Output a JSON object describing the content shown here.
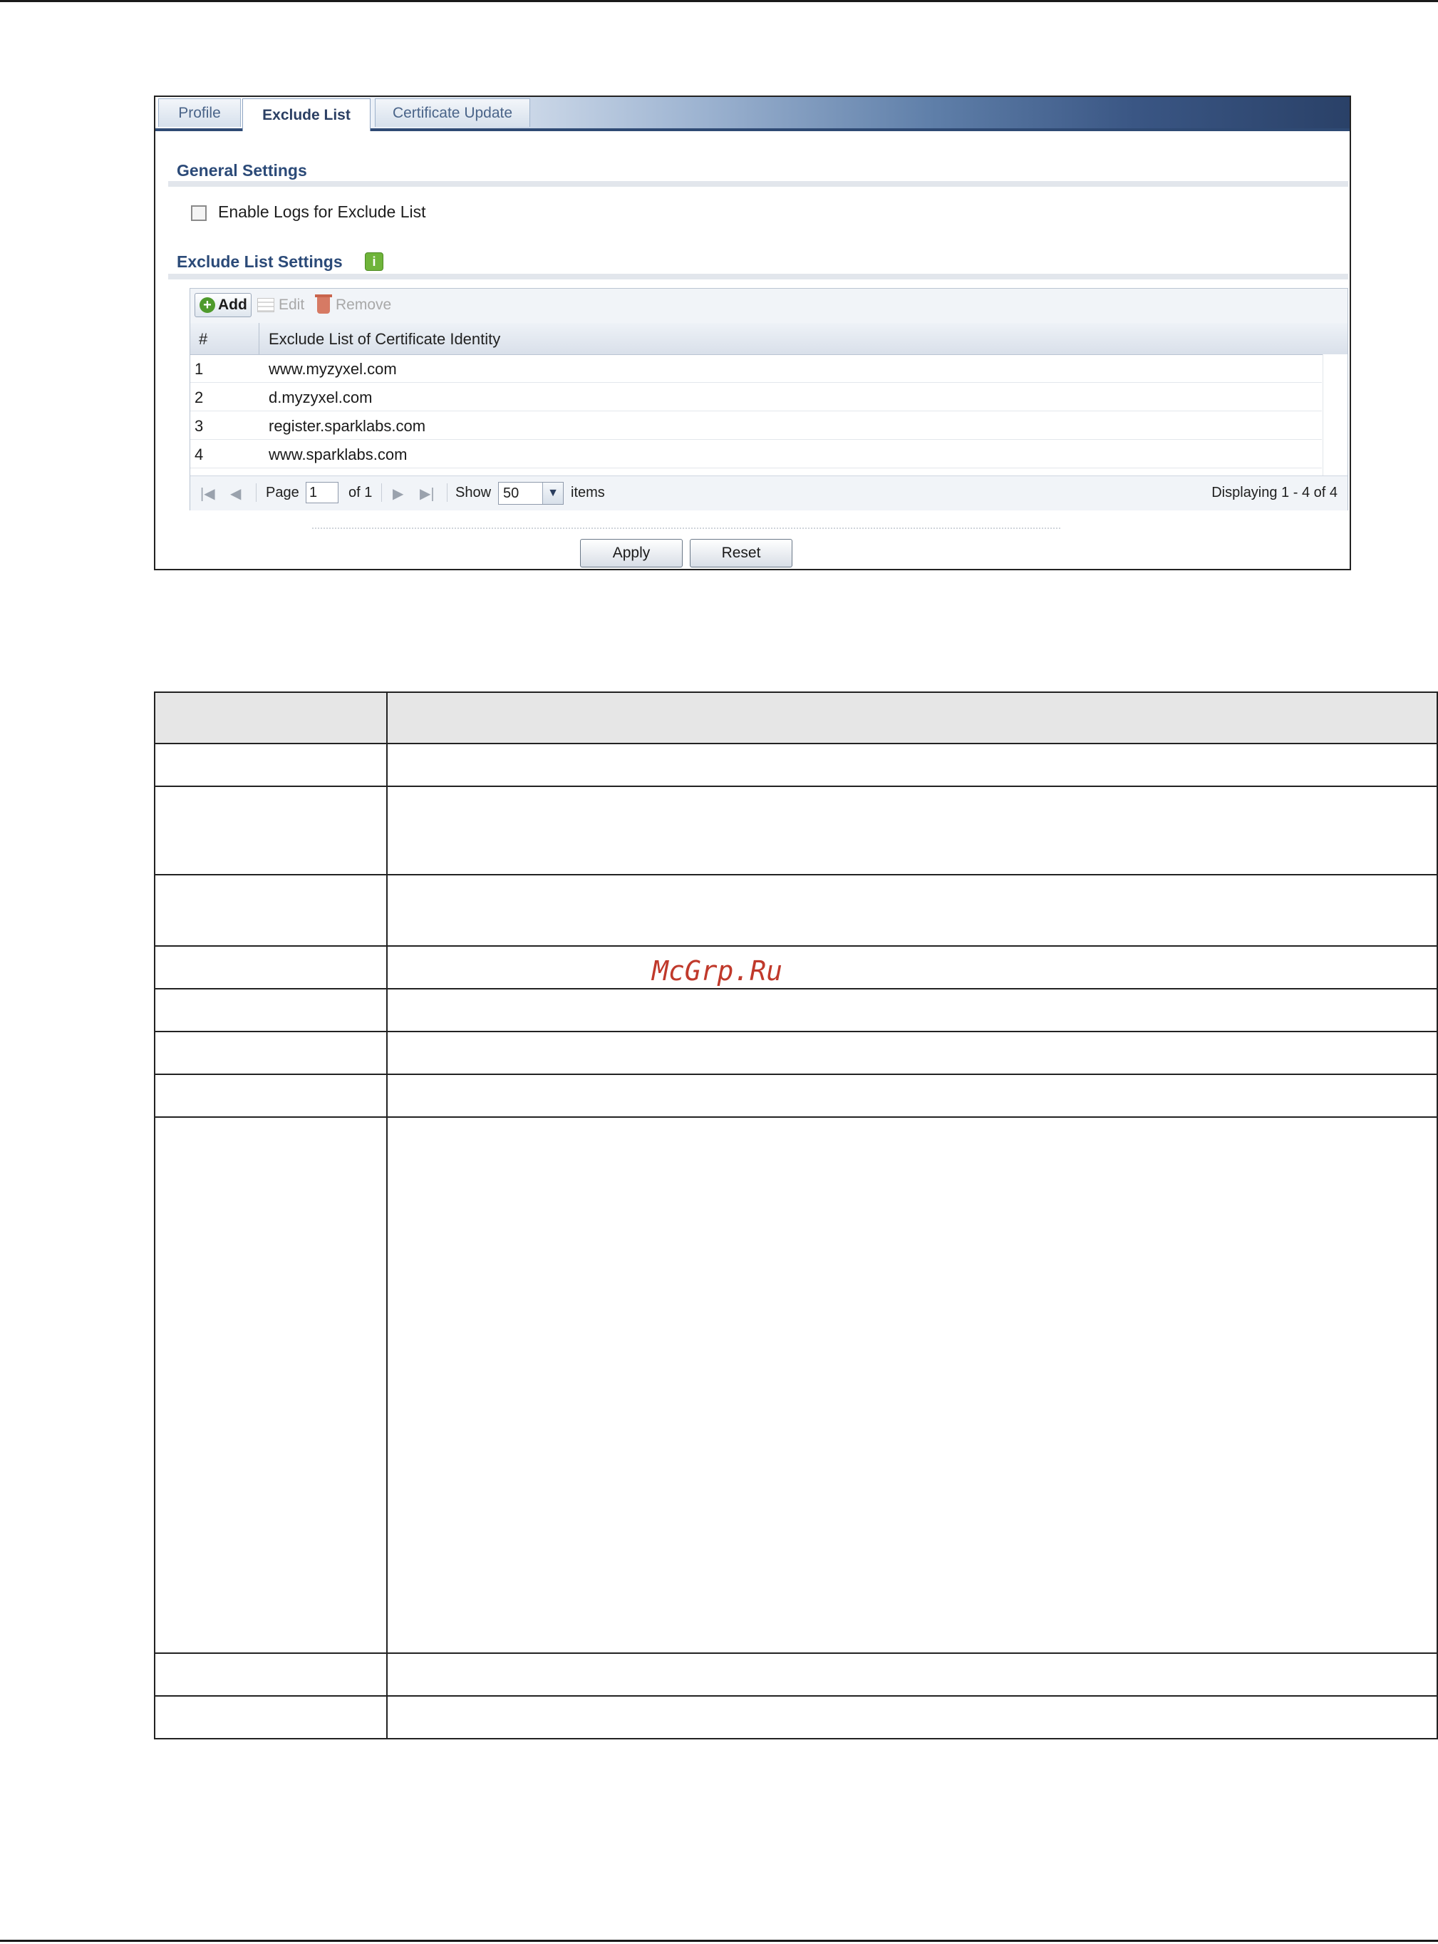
{
  "tabs": [
    {
      "label": "Profile",
      "active": false
    },
    {
      "label": "Exclude List",
      "active": true
    },
    {
      "label": "Certificate Update",
      "active": false
    }
  ],
  "general_settings": {
    "title": "General Settings",
    "enable_logs_label": "Enable Logs for Exclude List",
    "enable_logs_checked": false
  },
  "exclude_list_settings": {
    "title": "Exclude List Settings",
    "info_icon": "i",
    "toolbar": {
      "add": "Add",
      "edit": "Edit",
      "remove": "Remove"
    },
    "columns": {
      "num": "#",
      "identity": "Exclude List of Certificate Identity"
    },
    "rows": [
      {
        "num": "1",
        "identity": "www.myzyxel.com"
      },
      {
        "num": "2",
        "identity": "d.myzyxel.com"
      },
      {
        "num": "3",
        "identity": "register.sparklabs.com"
      },
      {
        "num": "4",
        "identity": "www.sparklabs.com"
      }
    ],
    "pager": {
      "page_label": "Page",
      "page_value": "1",
      "of_label": "of 1",
      "show_label": "Show",
      "show_value": "50",
      "items_label": "items",
      "displaying": "Displaying 1 - 4 of 4"
    }
  },
  "buttons": {
    "apply": "Apply",
    "reset": "Reset"
  },
  "watermark": "McGrp.Ru",
  "colors": {
    "accent": "#2b4a78",
    "tab_bar_dark": "#2a4168",
    "watermark": "#c0392b"
  }
}
